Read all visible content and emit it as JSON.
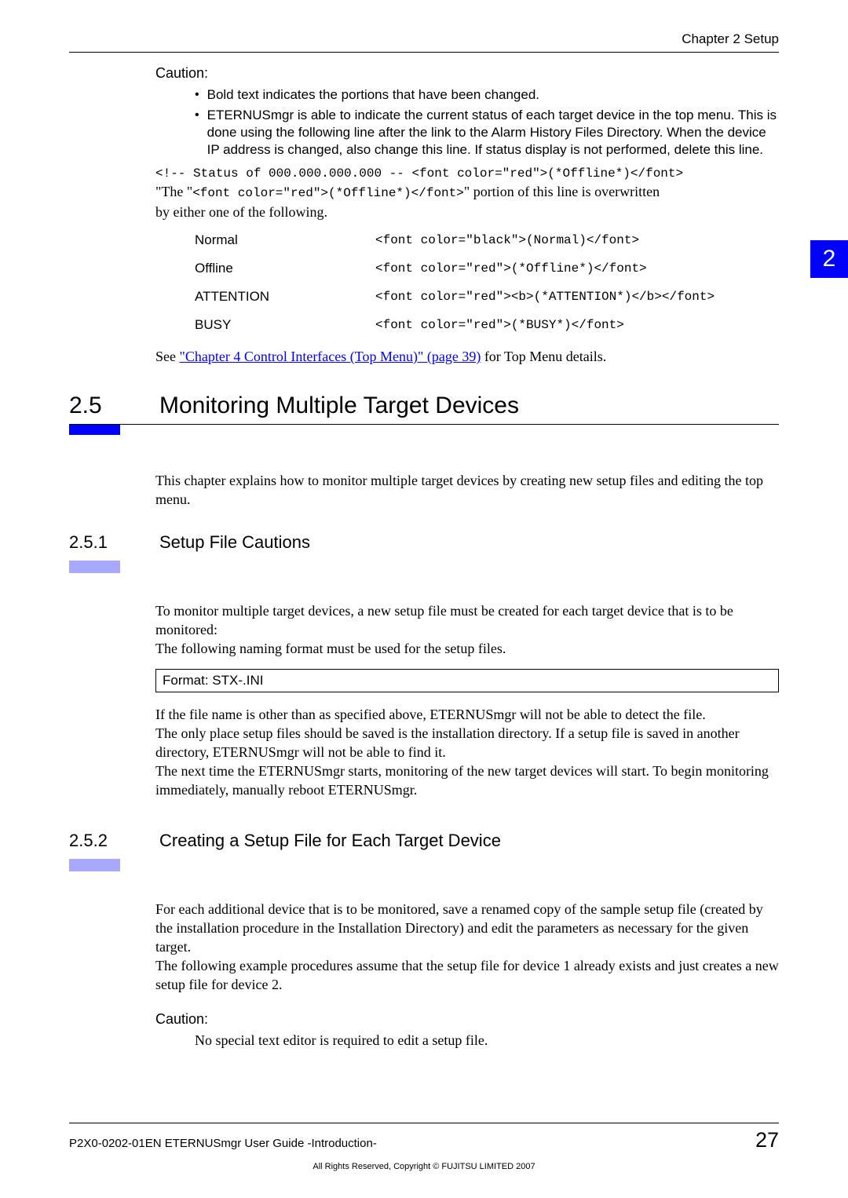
{
  "header": {
    "chapter": "Chapter 2  Setup"
  },
  "chapter_tab": "2",
  "caution1": {
    "label": "Caution:",
    "bullets": [
      "Bold text indicates the portions that have been changed.",
      "ETERNUSmgr is able to indicate the current status of each target device in the top menu. This is done using the following line after the link to the Alarm History Files Directory. When the device IP address is changed, also change this line. If status display is not performed, delete this line."
    ]
  },
  "status_block": {
    "line1": "<!-- Status of 000.000.000.000 -- <font color=\"red\">(*Offline*)</font>",
    "line2_prefix": "\"The \"",
    "line2_code": "<font color=\"red\">(*Offline*)</font>",
    "line2_suffix": "\" portion of this line is overwritten",
    "line3": "by either one of the following."
  },
  "status_table": [
    {
      "name": "Normal",
      "code": "<font color=\"black\">(Normal)</font>"
    },
    {
      "name": "Offline",
      "code": "<font color=\"red\">(*Offline*)</font>"
    },
    {
      "name": "ATTENTION",
      "code": "<font color=\"red\"><b>(*ATTENTION*)</b></font>"
    },
    {
      "name": "BUSY",
      "code": "<font color=\"red\">(*BUSY*)</font>"
    }
  ],
  "see": {
    "prefix": "See ",
    "link": "\"Chapter 4 Control Interfaces (Top Menu)\" (page 39)",
    "suffix": " for Top Menu details."
  },
  "sections": {
    "s25": {
      "num": "2.5",
      "title": "Monitoring Multiple Target Devices",
      "intro": "This chapter explains how to monitor multiple target devices by creating new setup files and editing the top menu."
    },
    "s251": {
      "num": "2.5.1",
      "title": "Setup File Cautions",
      "para1": "To monitor multiple target devices, a new setup file must be created for each target device that is to be monitored:\nThe following naming format must be used for the setup files.",
      "format": "Format: STX-.INI",
      "para2": "If the file name is other than as specified above, ETERNUSmgr will not be able to detect the file.\nThe only place setup files should be saved is the installation directory. If a setup file is saved in another directory, ETERNUSmgr will not be able to find it.\nThe next time the ETERNUSmgr starts, monitoring of the new target devices will start. To begin monitoring immediately, manually reboot ETERNUSmgr."
    },
    "s252": {
      "num": "2.5.2",
      "title": "Creating a Setup File for Each Target Device",
      "para1": "For each additional device that is to be monitored, save a renamed copy of the sample setup file (created by the installation procedure in the Installation Directory) and edit the parameters as necessary for the given target.\nThe following example procedures assume that the setup file for device 1 already exists and just creates a new setup file for device 2."
    }
  },
  "caution2": {
    "label": "Caution:",
    "text": "No special text editor is required to edit a setup file."
  },
  "footer": {
    "left": "P2X0-0202-01EN    ETERNUSmgr User Guide -Introduction-",
    "page": "27",
    "copyright": "All Rights Reserved, Copyright © FUJITSU LIMITED 2007"
  }
}
